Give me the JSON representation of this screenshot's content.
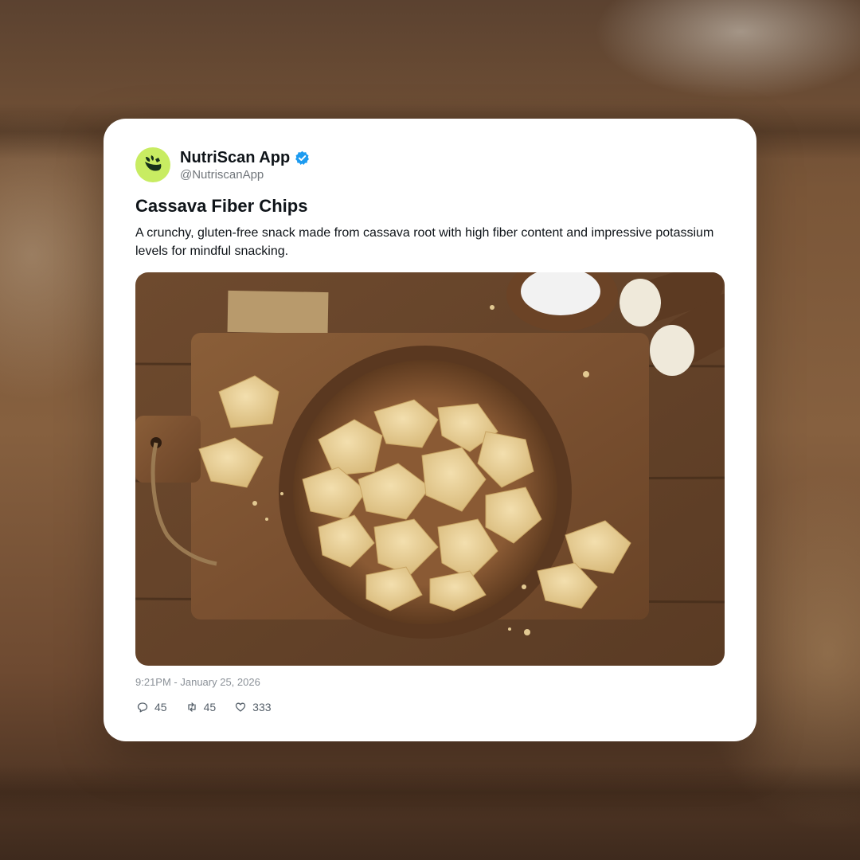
{
  "account": {
    "display_name": "NutriScan App",
    "handle": "@NutriscanApp",
    "verified": true,
    "avatar_icon": "leaf-logo-icon",
    "avatar_color": "#c8ec62"
  },
  "post": {
    "title": "Cassava Fiber Chips",
    "description": "A crunchy, gluten-free snack made from cassava root with high fiber content and impressive potassium levels for mindful snacking.",
    "image_subject": "wooden-bowl-of-cassava-chips",
    "timestamp": "9:21PM - January 25, 2026"
  },
  "engagement": {
    "replies": "45",
    "reposts": "45",
    "likes": "333"
  },
  "colors": {
    "verified_badge": "#1d9bf0",
    "text_primary": "#0f1419",
    "text_secondary": "#71767b"
  }
}
